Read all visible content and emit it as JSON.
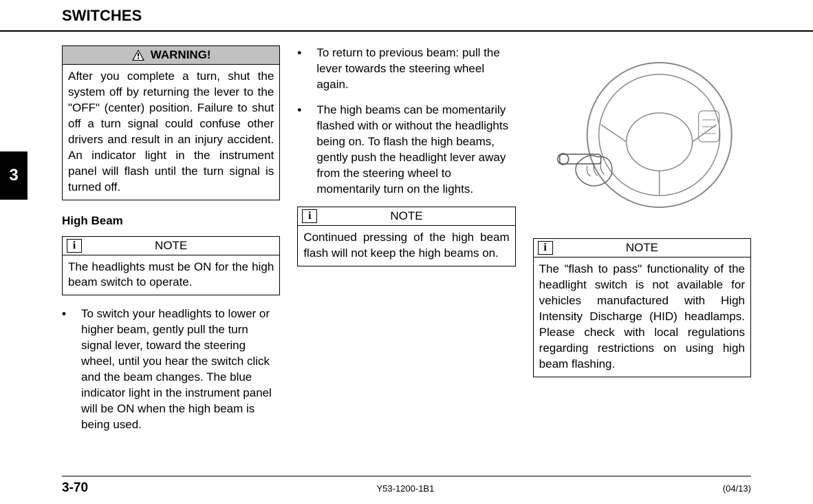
{
  "header": {
    "title": "SWITCHES"
  },
  "tab": {
    "number": "3"
  },
  "column1": {
    "warning": {
      "label": "WARNING!",
      "text": "After you complete a turn, shut the system off by returning the lever to the \"OFF\" (center) position.  Failure to shut off a turn signal could confuse other drivers and result in an injury accident. An indicator light in the instrument panel will flash until the turn signal is turned off."
    },
    "heading": "High Beam",
    "note": {
      "label": "NOTE",
      "icon": "i",
      "text": "The headlights must be ON for the high beam switch to operate."
    },
    "bullet1": "To switch your headlights to lower or higher beam, gently pull the turn signal lever, toward the steering wheel, until you hear the switch click and the beam changes. The blue indicator light in the instrument panel will be ON when the high beam is being used."
  },
  "column2": {
    "bullet1": "To return to previous beam: pull the lever towards the steering wheel again.",
    "bullet2": "The high beams can be momentarily flashed with or without the headlights being on. To flash the high beams, gently push the headlight lever away from the steering wheel to momentarily turn on the lights.",
    "note": {
      "label": "NOTE",
      "icon": "i",
      "text": "Continued pressing of the high beam flash will not keep the high beams on."
    }
  },
  "column3": {
    "figure_alt": "steering-wheel-lever-diagram",
    "note": {
      "label": "NOTE",
      "icon": "i",
      "text": "The \"flash to pass\" functionality of the headlight switch is not available for vehicles manufactured with High Intensity Discharge (HID) headlamps. Please check with local regulations regarding restrictions on using high beam flashing."
    }
  },
  "footer": {
    "page": "3-70",
    "doc": "Y53-1200-1B1",
    "date": "(04/13)"
  }
}
